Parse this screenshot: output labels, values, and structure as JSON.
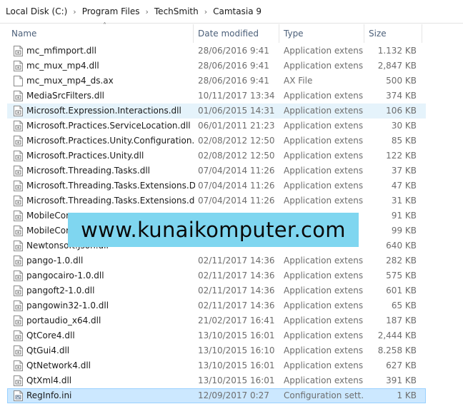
{
  "breadcrumb": [
    "Local Disk (C:)",
    "Program Files",
    "TechSmith",
    "Camtasia 9"
  ],
  "columns": {
    "name": "Name",
    "date": "Date modified",
    "type": "Type",
    "size": "Size"
  },
  "files": [
    {
      "name": "mc_mfimport.dll",
      "date": "28/06/2016 9:41",
      "type": "Application extens...",
      "size": "1.132 KB",
      "icon": "dll-file-icon",
      "state": ""
    },
    {
      "name": "mc_mux_mp4.dll",
      "date": "28/06/2016 9:41",
      "type": "Application extens...",
      "size": "2,847 KB",
      "icon": "dll-file-icon",
      "state": ""
    },
    {
      "name": "mc_mux_mp4_ds.ax",
      "date": "28/06/2016 9:41",
      "type": "AX File",
      "size": "500 KB",
      "icon": "generic-file-icon",
      "state": ""
    },
    {
      "name": "MediaSrcFilters.dll",
      "date": "10/11/2017 13:34",
      "type": "Application extens...",
      "size": "374 KB",
      "icon": "dll-file-icon",
      "state": ""
    },
    {
      "name": "Microsoft.Expression.Interactions.dll",
      "date": "01/06/2015 14:31",
      "type": "Application extens...",
      "size": "106 KB",
      "icon": "dll-file-icon",
      "state": "hover"
    },
    {
      "name": "Microsoft.Practices.ServiceLocation.dll",
      "date": "06/01/2011 21:23",
      "type": "Application extens...",
      "size": "30 KB",
      "icon": "dll-file-icon",
      "state": ""
    },
    {
      "name": "Microsoft.Practices.Unity.Configuration.dll",
      "date": "02/08/2012 12:50",
      "type": "Application extens...",
      "size": "85 KB",
      "icon": "dll-file-icon",
      "state": ""
    },
    {
      "name": "Microsoft.Practices.Unity.dll",
      "date": "02/08/2012 12:50",
      "type": "Application extens...",
      "size": "122 KB",
      "icon": "dll-file-icon",
      "state": ""
    },
    {
      "name": "Microsoft.Threading.Tasks.dll",
      "date": "07/04/2014 11:26",
      "type": "Application extens...",
      "size": "37 KB",
      "icon": "dll-file-icon",
      "state": ""
    },
    {
      "name": "Microsoft.Threading.Tasks.Extensions.De...",
      "date": "07/04/2014 11:26",
      "type": "Application extens...",
      "size": "47 KB",
      "icon": "dll-file-icon",
      "state": ""
    },
    {
      "name": "Microsoft.Threading.Tasks.Extensions.dll",
      "date": "07/04/2014 11:26",
      "type": "Application extens...",
      "size": "31 KB",
      "icon": "dll-file-icon",
      "state": ""
    },
    {
      "name": "MobileCor",
      "date": "",
      "type": "",
      "size": "91 KB",
      "icon": "dll-file-icon",
      "state": ""
    },
    {
      "name": "MobileCor",
      "date": "",
      "type": "",
      "size": "99 KB",
      "icon": "dll-file-icon",
      "state": ""
    },
    {
      "name": "Newtonsoft.Json.dll",
      "date": "",
      "type": "",
      "size": "640 KB",
      "icon": "dll-file-icon",
      "state": ""
    },
    {
      "name": "pango-1.0.dll",
      "date": "02/11/2017 14:36",
      "type": "Application extens...",
      "size": "282 KB",
      "icon": "dll-file-icon",
      "state": ""
    },
    {
      "name": "pangocairo-1.0.dll",
      "date": "02/11/2017 14:36",
      "type": "Application extens...",
      "size": "575 KB",
      "icon": "dll-file-icon",
      "state": ""
    },
    {
      "name": "pangoft2-1.0.dll",
      "date": "02/11/2017 14:36",
      "type": "Application extens...",
      "size": "601 KB",
      "icon": "dll-file-icon",
      "state": ""
    },
    {
      "name": "pangowin32-1.0.dll",
      "date": "02/11/2017 14:36",
      "type": "Application extens...",
      "size": "65 KB",
      "icon": "dll-file-icon",
      "state": ""
    },
    {
      "name": "portaudio_x64.dll",
      "date": "21/02/2017 16:41",
      "type": "Application extens...",
      "size": "187 KB",
      "icon": "dll-file-icon",
      "state": ""
    },
    {
      "name": "QtCore4.dll",
      "date": "13/10/2015 16:01",
      "type": "Application extens...",
      "size": "2,444 KB",
      "icon": "dll-file-icon",
      "state": ""
    },
    {
      "name": "QtGui4.dll",
      "date": "13/10/2015 16:10",
      "type": "Application extens...",
      "size": "8.258 KB",
      "icon": "dll-file-icon",
      "state": ""
    },
    {
      "name": "QtNetwork4.dll",
      "date": "13/10/2015 16:01",
      "type": "Application extens...",
      "size": "627 KB",
      "icon": "dll-file-icon",
      "state": ""
    },
    {
      "name": "QtXml4.dll",
      "date": "13/10/2015 16:01",
      "type": "Application extens...",
      "size": "391 KB",
      "icon": "dll-file-icon",
      "state": ""
    },
    {
      "name": "RegInfo.ini",
      "date": "12/09/2017 0:27",
      "type": "Configuration sett...",
      "size": "1 KB",
      "icon": "ini-file-icon",
      "state": "selected"
    }
  ],
  "watermark": "www.kunaikomputer.com",
  "colors": {
    "hover_bg": "#e5f3fb",
    "selected_bg": "#cce8ff",
    "selected_border": "#99d1ff",
    "watermark_bg": "#7fd6f0",
    "header_text": "#4c607a"
  }
}
